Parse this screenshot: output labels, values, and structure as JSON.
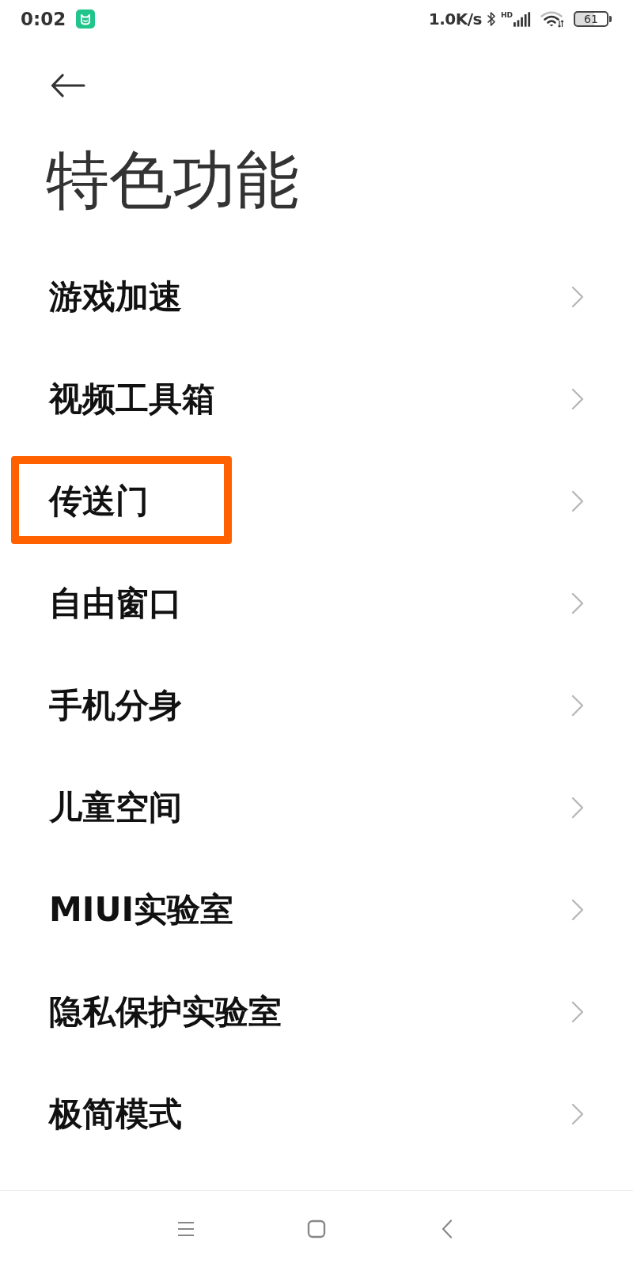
{
  "status_bar": {
    "time": "0:02",
    "speed": "1.0K/s",
    "network_type": "HD",
    "battery": "61"
  },
  "header": {
    "title": "特色功能"
  },
  "items": [
    {
      "label": "游戏加速",
      "highlighted": false
    },
    {
      "label": "视频工具箱",
      "highlighted": false
    },
    {
      "label": "传送门",
      "highlighted": true
    },
    {
      "label": "自由窗口",
      "highlighted": false
    },
    {
      "label": "手机分身",
      "highlighted": false
    },
    {
      "label": "儿童空间",
      "highlighted": false
    },
    {
      "label": "MIUI实验室",
      "highlighted": false
    },
    {
      "label": "隐私保护实验室",
      "highlighted": false
    },
    {
      "label": "极简模式",
      "highlighted": false
    }
  ]
}
